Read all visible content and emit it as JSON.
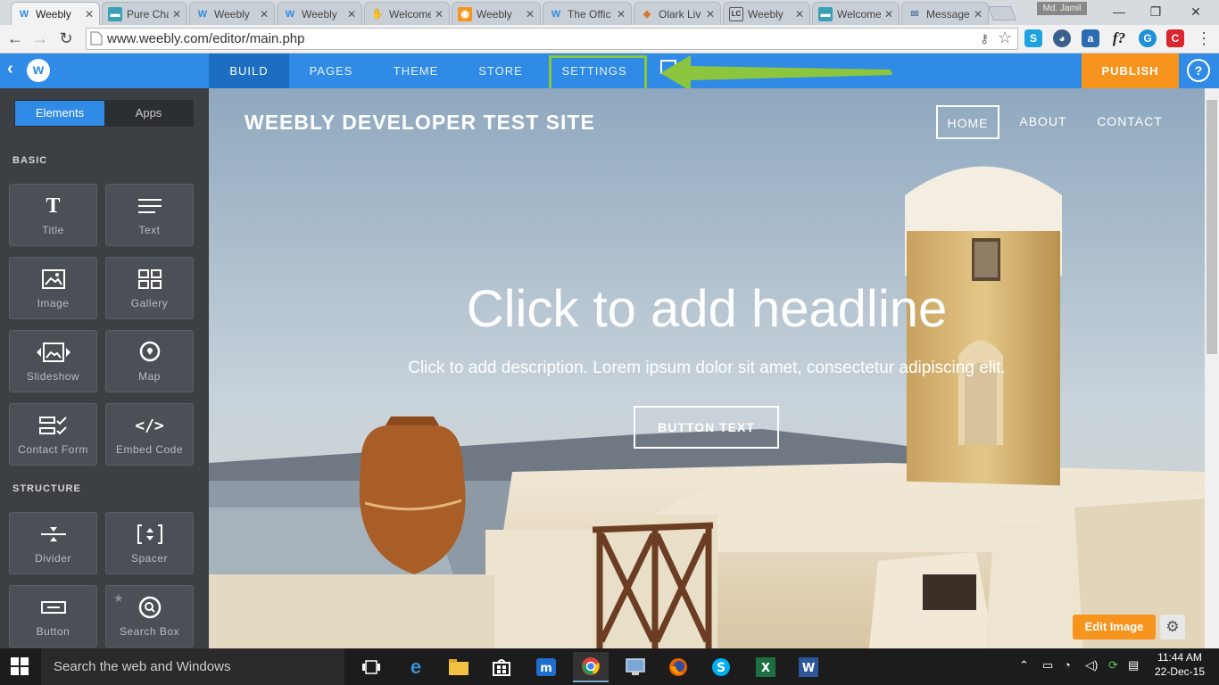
{
  "browser": {
    "tabs": [
      {
        "title": "Weebly",
        "icon": "weebly-icon",
        "active": true
      },
      {
        "title": "Pure Cha",
        "icon": "chat-icon"
      },
      {
        "title": "Weebly",
        "icon": "weebly-icon"
      },
      {
        "title": "Weebly",
        "icon": "weebly-icon"
      },
      {
        "title": "Welcome",
        "icon": "handshake-icon"
      },
      {
        "title": "Weebly",
        "icon": "app-icon"
      },
      {
        "title": "The Offic",
        "icon": "weebly-icon"
      },
      {
        "title": "Olark Liv",
        "icon": "olark-icon"
      },
      {
        "title": "Weebly",
        "icon": "livechat-icon"
      },
      {
        "title": "Welcome",
        "icon": "chat-icon"
      },
      {
        "title": "Message",
        "icon": "mail-icon"
      }
    ],
    "user_badge": "Md. Jamil",
    "url": "www.weebly.com/editor/main.php"
  },
  "editor": {
    "nav": [
      "BUILD",
      "PAGES",
      "THEME",
      "STORE",
      "SETTINGS"
    ],
    "active_nav": "BUILD",
    "publish_label": "PUBLISH",
    "help_label": "?",
    "sidebar": {
      "tabs": [
        "Elements",
        "Apps"
      ],
      "sections": [
        {
          "title": "BASIC",
          "items": [
            "Title",
            "Text",
            "Image",
            "Gallery",
            "Slideshow",
            "Map",
            "Contact Form",
            "Embed Code"
          ]
        },
        {
          "title": "STRUCTURE",
          "items": [
            "Divider",
            "Spacer",
            "Button",
            "Search Box"
          ]
        }
      ]
    }
  },
  "site": {
    "title": "WEEBLY DEVELOPER TEST SITE",
    "nav": [
      "HOME",
      "ABOUT",
      "CONTACT"
    ],
    "headline": "Click to add headline",
    "description": "Click to add description. Lorem ipsum dolor sit amet, consectetur adipiscing elit.",
    "button_label": "BUTTON TEXT",
    "edit_image_label": "Edit Image"
  },
  "taskbar": {
    "search_placeholder": "Search the web and Windows",
    "time": "11:44 AM",
    "date": "22-Dec-15"
  },
  "colors": {
    "accent": "#2f8be6",
    "publish": "#f7941d",
    "highlight": "#8cc63f",
    "sidebar": "#3c4045"
  }
}
